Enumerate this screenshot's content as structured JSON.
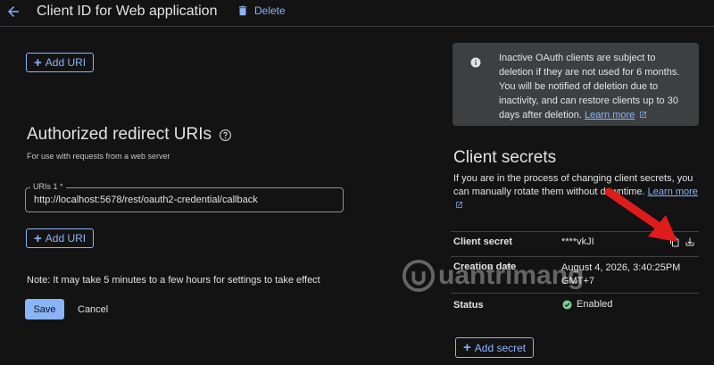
{
  "header": {
    "title": "Client ID for Web application",
    "delete_label": "Delete"
  },
  "origins": {
    "add_uri_label": "Add URI"
  },
  "redirects": {
    "title": "Authorized redirect URIs",
    "subtitle": "For use with requests from a web server",
    "field_label": "URIs 1 *",
    "field_value": "http://localhost:5678/rest/oauth2-credential/callback",
    "add_uri_label": "Add URI"
  },
  "footer": {
    "note": "Note: It may take 5 minutes to a few hours for settings to take effect",
    "save_label": "Save",
    "cancel_label": "Cancel"
  },
  "info": {
    "text": "Inactive OAuth clients are subject to deletion if they are not used for 6 months. You will be notified of deletion due to inactivity, and can restore clients up to 30 days after deletion.",
    "link": "Learn more"
  },
  "client_secrets": {
    "title": "Client secrets",
    "description": "If you are in the process of changing client secrets, you can manually rotate them without downtime.",
    "link": "Learn more",
    "rows": [
      {
        "label": "Client secret",
        "value": "****vkJI"
      },
      {
        "label": "Creation date",
        "value": "August 4, 2026, 3:40:25PM GMT+7"
      },
      {
        "label": "Status",
        "value": "Enabled"
      }
    ],
    "add_secret_label": "Add secret"
  },
  "watermark": {
    "text": "uantrimang"
  },
  "colors": {
    "background": "#131314",
    "accent": "#8ab4f8",
    "info_box": "#3c4043",
    "status_ok": "#81c995",
    "annotation": "#e01b1b"
  }
}
